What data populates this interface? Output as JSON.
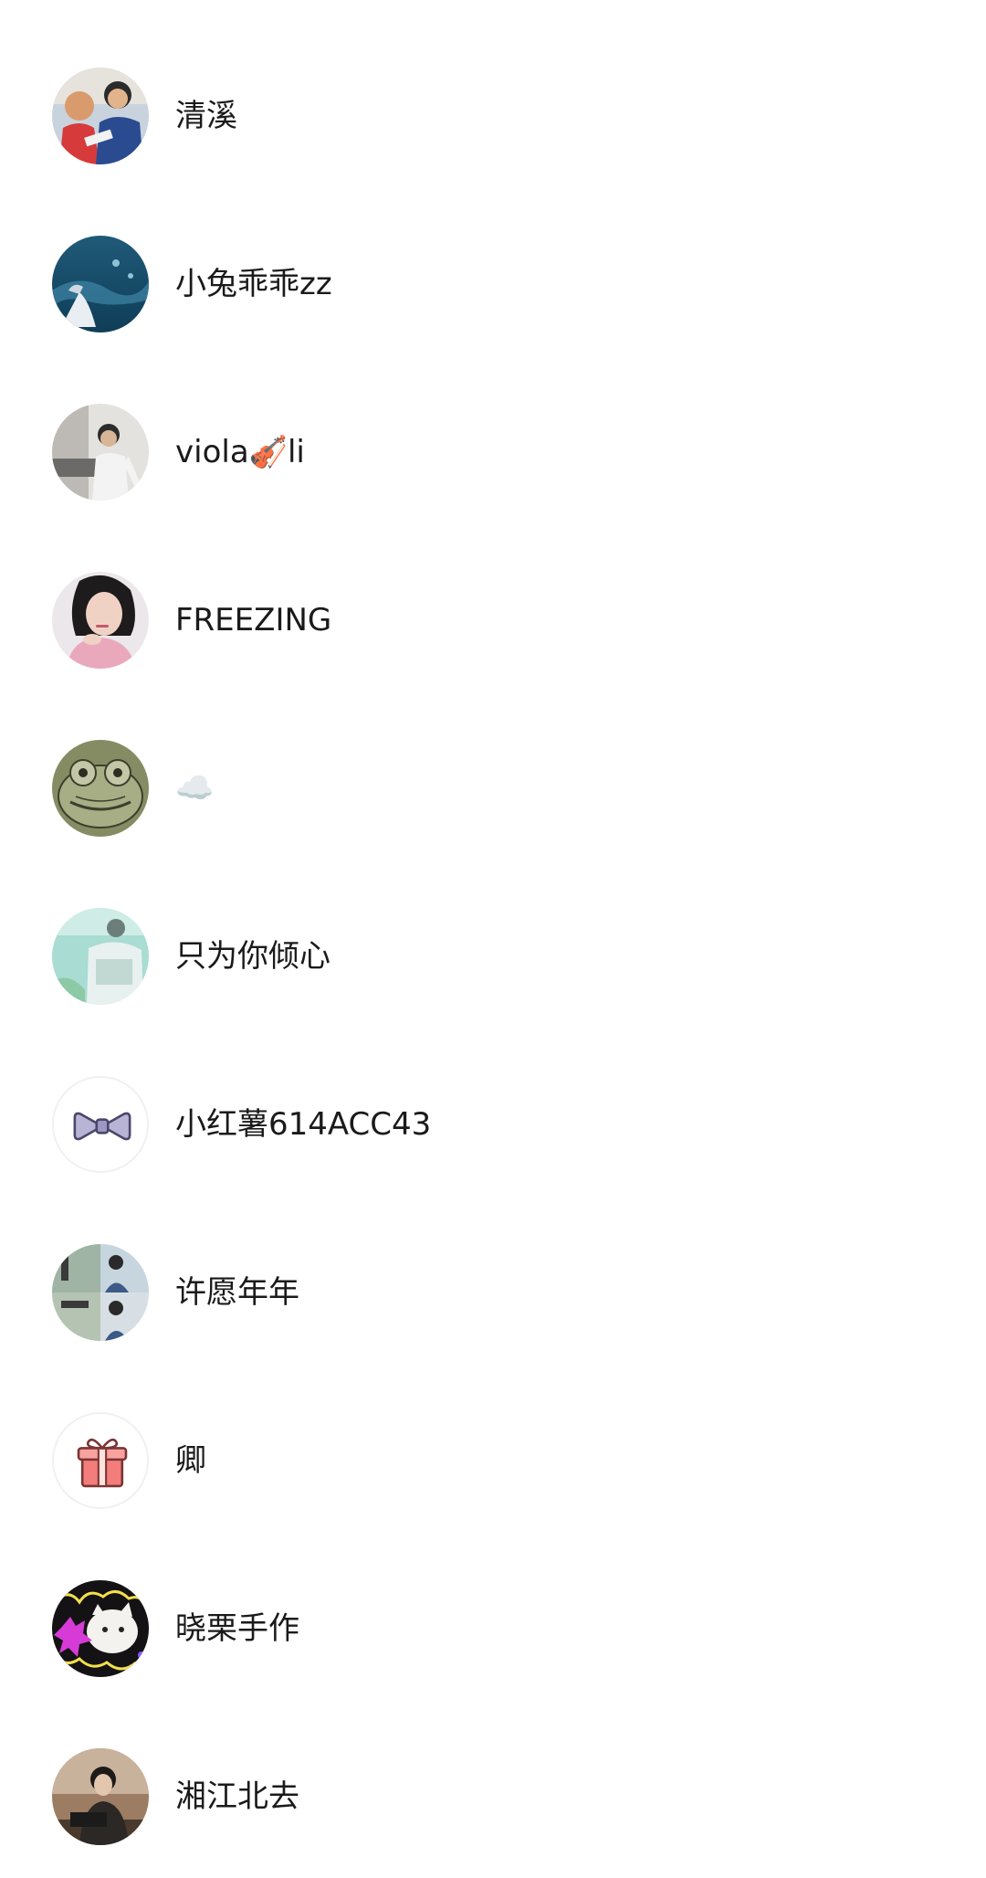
{
  "contacts": [
    {
      "name": "清溪",
      "avatar": "photo-two-people"
    },
    {
      "name": "小兔乖乖zz",
      "avatar": "photo-ocean"
    },
    {
      "name": "viola🎻li",
      "avatar": "photo-man-desk"
    },
    {
      "name": "FREEZING",
      "avatar": "photo-woman-pink"
    },
    {
      "name": "☁️",
      "avatar": "frog-illustration"
    },
    {
      "name": "只为你倾心",
      "avatar": "photo-teal"
    },
    {
      "name": "小红薯614ACC43",
      "avatar": "bow-icon"
    },
    {
      "name": "许愿年年",
      "avatar": "photo-grid-people"
    },
    {
      "name": "卿",
      "avatar": "gift-icon"
    },
    {
      "name": "晓栗手作",
      "avatar": "cat-illustration"
    },
    {
      "name": "湘江北去",
      "avatar": "photo-woman-laptop"
    }
  ],
  "colors": {
    "background": "#ffffff",
    "text": "#1a1a1a",
    "divider": "#f0f0f0"
  }
}
